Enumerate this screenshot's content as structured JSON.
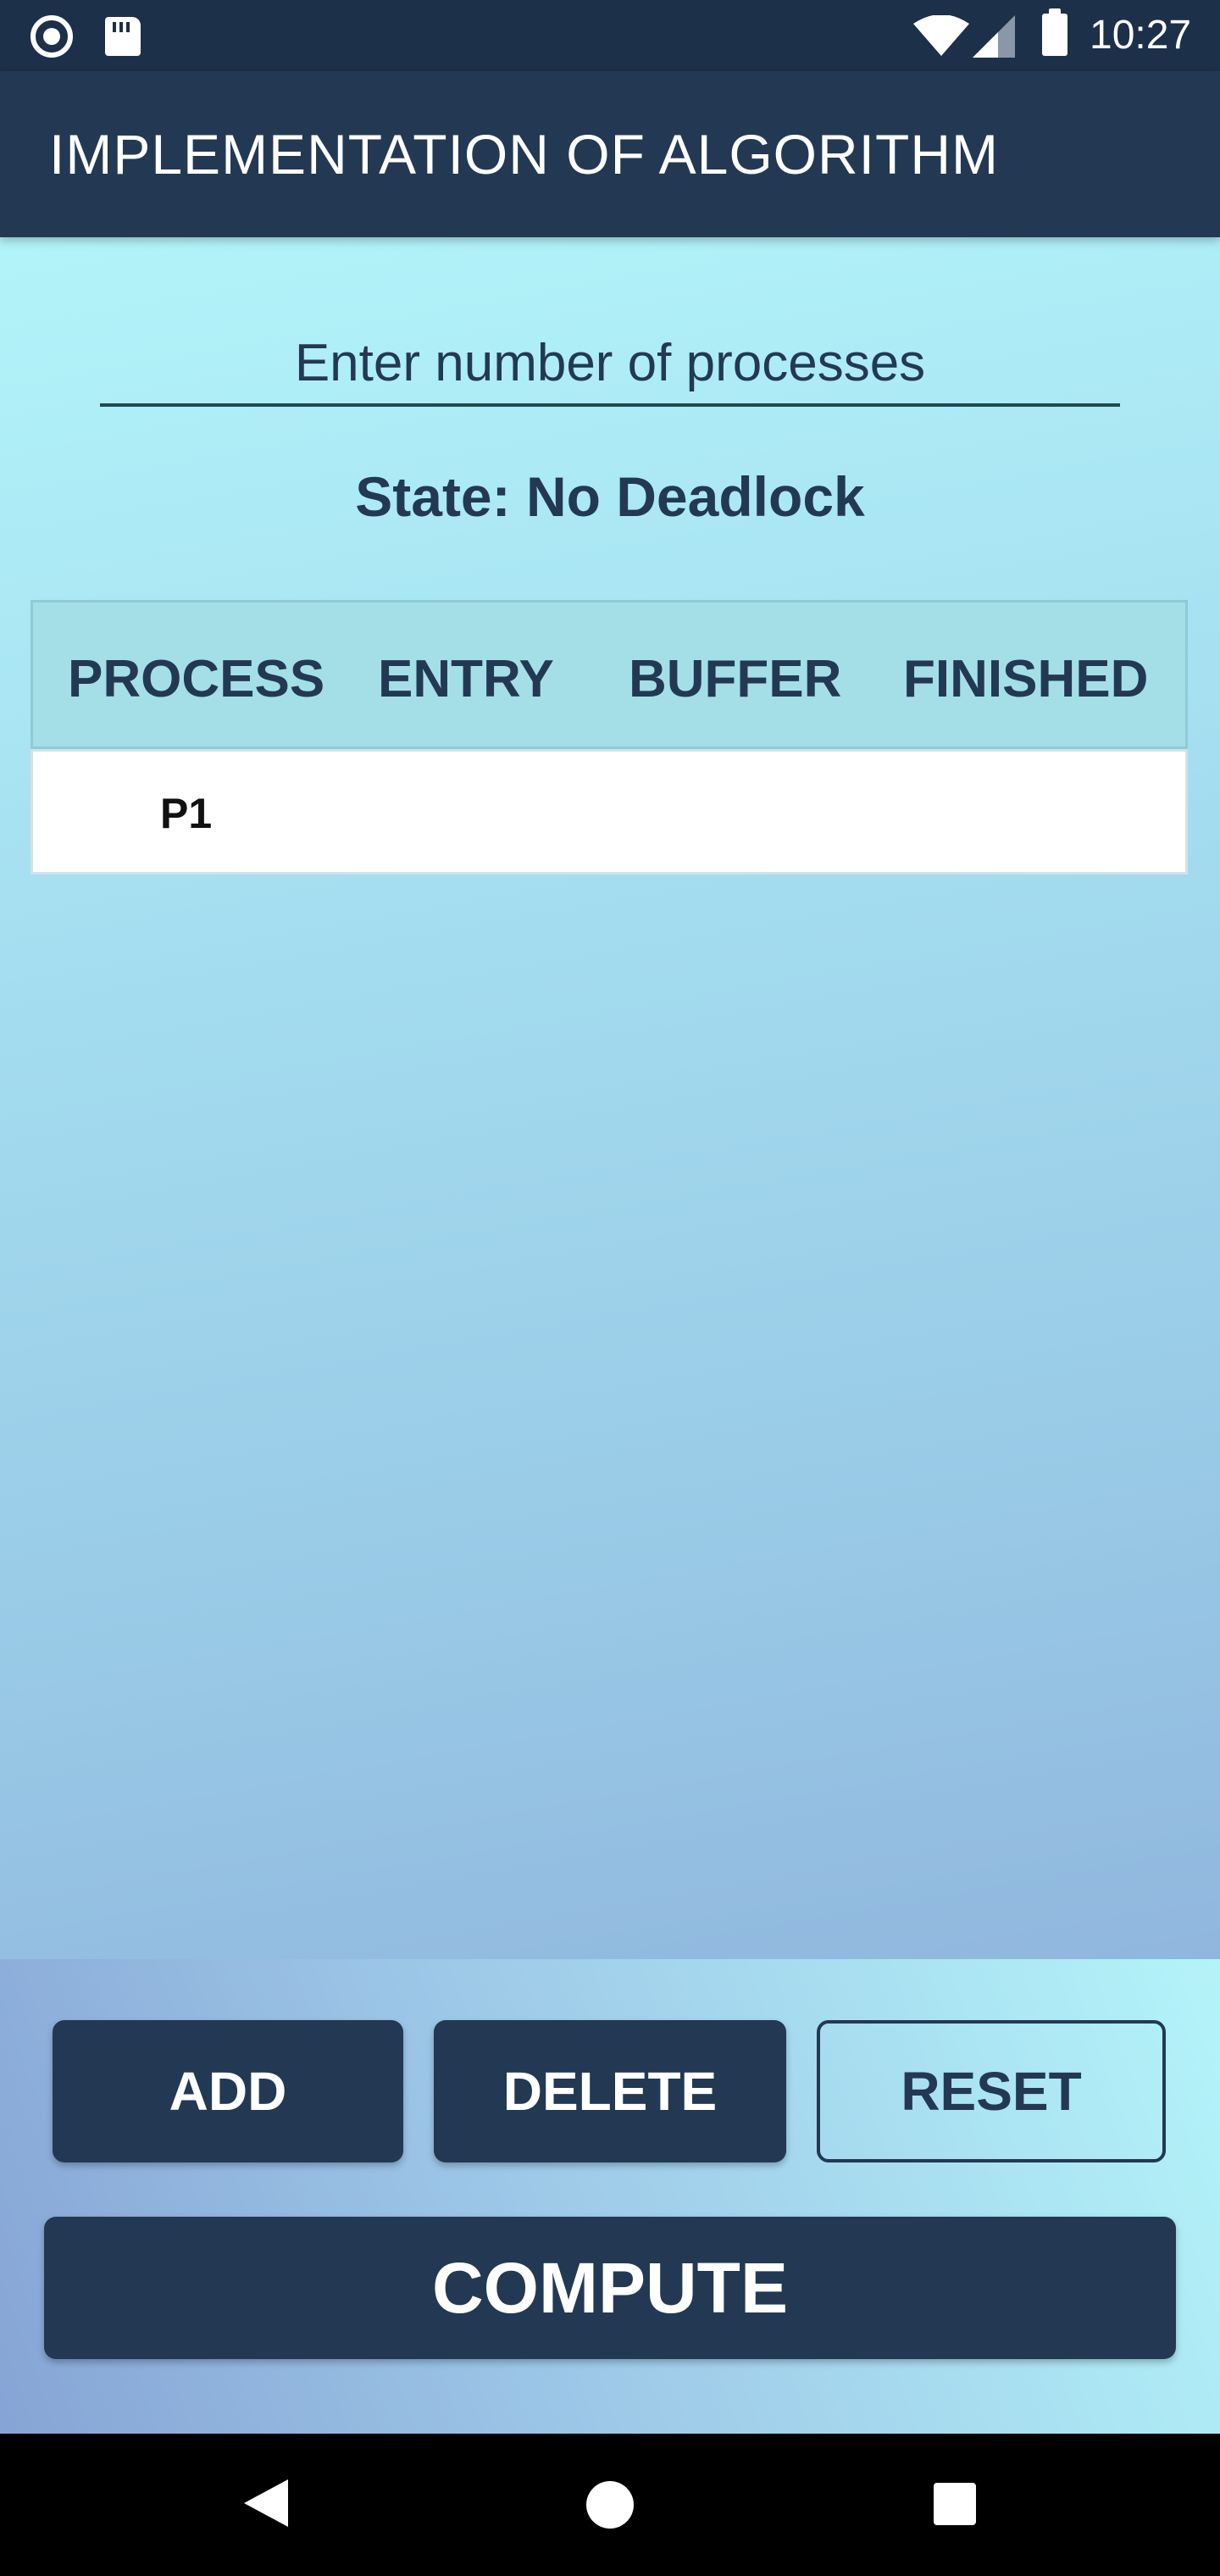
{
  "status_bar": {
    "time": "10:27",
    "icons": [
      "record-icon",
      "sd-card-icon",
      "wifi-icon",
      "signal-icon",
      "battery-icon"
    ]
  },
  "app_bar": {
    "title": "IMPLEMENTATION OF ALGORITHM"
  },
  "input": {
    "placeholder": "Enter number of processes",
    "value": ""
  },
  "state": {
    "text": "State: No Deadlock"
  },
  "table": {
    "headers": [
      "PROCESS",
      "ENTRY",
      "BUFFER",
      "FINISHED"
    ],
    "rows": [
      {
        "process": "P1",
        "entry": "",
        "buffer": "",
        "finished": ""
      }
    ]
  },
  "buttons": {
    "add": "ADD",
    "delete": "DELETE",
    "reset": "RESET",
    "compute": "COMPUTE"
  },
  "nav": {
    "icons": [
      "back-icon",
      "home-icon",
      "recent-apps-icon"
    ]
  },
  "colors": {
    "primary": "#233953",
    "gradient_top": "#b2f4f9",
    "gradient_bottom": "#8fb2dc"
  }
}
